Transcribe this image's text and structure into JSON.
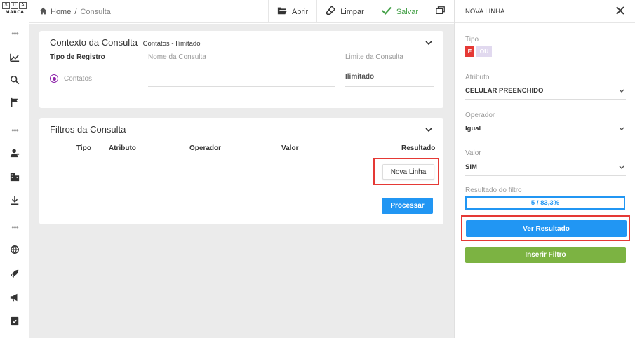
{
  "logo": {
    "letters": [
      "S",
      "U",
      "A"
    ],
    "sub": "MARCA"
  },
  "sidebar": {
    "icons": [
      "more-dots-icon",
      "chart-icon",
      "search-icon",
      "flag-icon",
      "more-dots-icon",
      "contacts-icon",
      "building-icon",
      "download-icon",
      "more-dots-icon",
      "globe-icon",
      "rocket-icon",
      "megaphone-icon",
      "checklist-icon"
    ]
  },
  "breadcrumb": {
    "home": "Home",
    "separator": "/",
    "current": "Consulta"
  },
  "toolbar": {
    "abrir": "Abrir",
    "limpar": "Limpar",
    "salvar": "Salvar"
  },
  "contexto": {
    "title": "Contexto da Consulta",
    "subtitle": "Contatos - Ilimitado",
    "tipo_registro_label": "Tipo de Registro",
    "radio_option": "Contatos",
    "nome_label": "Nome da Consulta",
    "nome_value": "",
    "limite_label": "Limite da Consulta",
    "limite_value": "Ilimitado"
  },
  "filtros": {
    "title": "Filtros da Consulta",
    "columns": [
      "Tipo",
      "Atributo",
      "Operador",
      "Valor",
      "Resultado"
    ],
    "nova_linha": "Nova Linha",
    "processar": "Processar"
  },
  "panel": {
    "title": "NOVA LINHA",
    "tipo_label": "Tipo",
    "tipo_e": "E",
    "tipo_ou": "OU",
    "atributo_label": "Atributo",
    "atributo_value": "CELULAR PREENCHIDO",
    "operador_label": "Operador",
    "operador_value": "Igual",
    "valor_label": "Valor",
    "valor_value": "SIM",
    "resultado_label": "Resultado do filtro",
    "resultado_value": "5 / 83,3%",
    "ver_resultado": "Ver Resultado",
    "inserir_filtro": "Inserir Filtro"
  },
  "colors": {
    "primary": "#2196f3",
    "success": "#7cb342",
    "danger": "#e53935",
    "radio": "#8e24aa"
  }
}
